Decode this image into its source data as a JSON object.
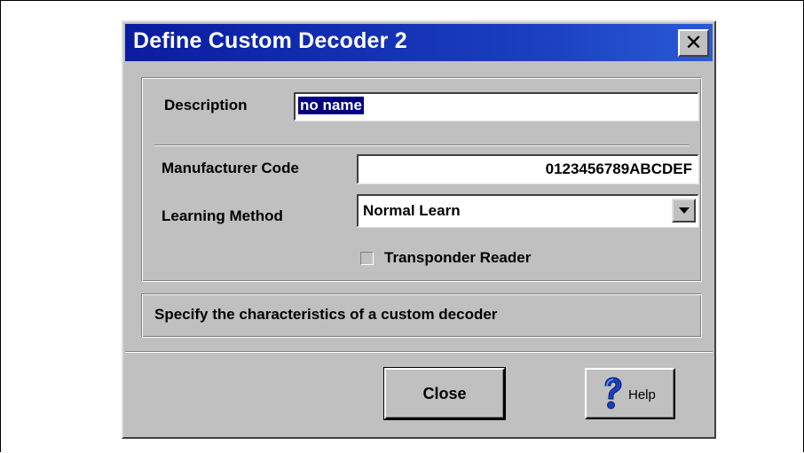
{
  "window": {
    "title": "Define Custom Decoder 2",
    "close_glyph": "✕"
  },
  "form": {
    "description_label": "Description",
    "description_value": "no name",
    "manufacturer_code_label": "Manufacturer Code",
    "manufacturer_code_value": "0123456789ABCDEF",
    "learning_method_label": "Learning Method",
    "learning_method_value": "Normal Learn",
    "transponder_label": "Transponder Reader",
    "transponder_checked": false
  },
  "status": {
    "text": "Specify the characteristics of a custom decoder"
  },
  "buttons": {
    "close_label": "Close",
    "help_label": "Help",
    "help_icon": "question-mark-icon"
  },
  "colors": {
    "titlebar": "#0a1ca0",
    "dialog_face": "#c0c0c0",
    "selection": "#000080",
    "help_icon": "#1a3fc0"
  }
}
